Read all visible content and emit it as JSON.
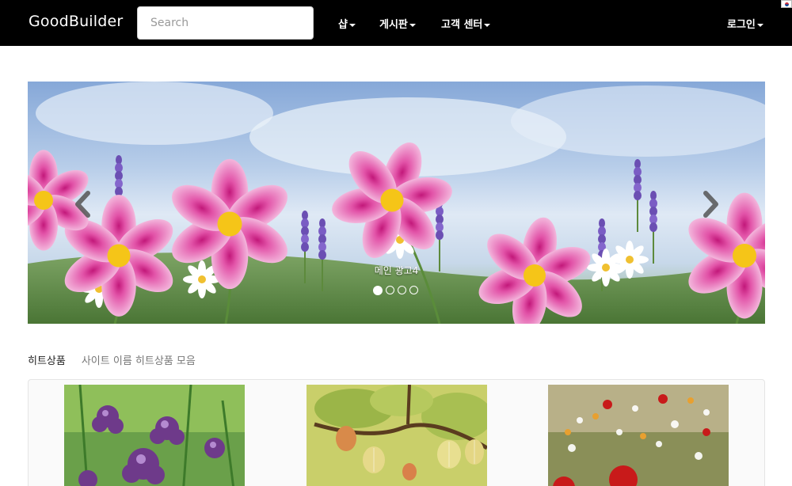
{
  "navbar": {
    "brand": "GoodBuilder",
    "search_placeholder": "Search",
    "menus": [
      {
        "label": "샵"
      },
      {
        "label": "게시판"
      },
      {
        "label": "고객 센터"
      }
    ],
    "login_label": "로그인",
    "flag_icon": "korea-flag-icon"
  },
  "carousel": {
    "caption": "메인 광고4",
    "slide_count": 4,
    "active_index": 0,
    "prev_icon": "chevron-left-icon",
    "next_icon": "chevron-right-icon"
  },
  "hit_products": {
    "title": "히트상품",
    "subtitle": "사이트 이름 히트상품 모음",
    "items": [
      {
        "image": "purple-thyme-flowers"
      },
      {
        "image": "gooseberry-branch"
      },
      {
        "image": "red-poppy-field"
      }
    ]
  },
  "colors": {
    "navbar_bg": "#000000",
    "navbar_text": "#ffffff",
    "page_bg": "#ffffff"
  }
}
